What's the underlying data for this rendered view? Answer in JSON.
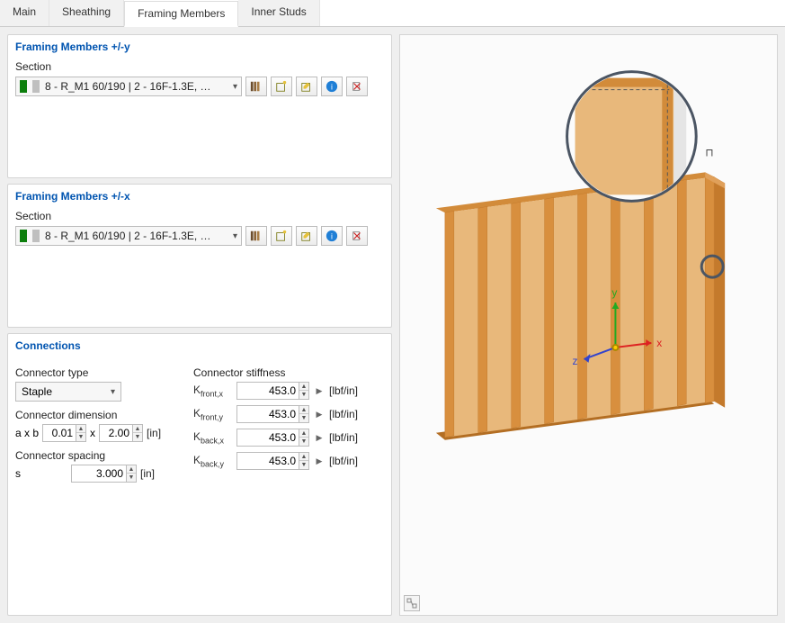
{
  "tabs": [
    "Main",
    "Sheathing",
    "Framing Members",
    "Inner Studs"
  ],
  "activeTab": 2,
  "panelY": {
    "title": "Framing Members +/-y",
    "sectionLabel": "Section",
    "combo": "8 - R_M1 60/190 | 2 - 16F-1.3E, Softwo..."
  },
  "panelX": {
    "title": "Framing Members +/-x",
    "sectionLabel": "Section",
    "combo": "8 - R_M1 60/190 | 2 - 16F-1.3E, Softwo..."
  },
  "connections": {
    "title": "Connections",
    "connectorTypeLabel": "Connector type",
    "connectorType": "Staple",
    "connectorDimensionLabel": "Connector dimension",
    "dim": {
      "label": "a x b",
      "a": "0.01",
      "b": "2.00",
      "unit": "[in]"
    },
    "connectorSpacingLabel": "Connector spacing",
    "spacing": {
      "label": "s",
      "value": "3.000",
      "unit": "[in]"
    },
    "stiffnessTitle": "Connector stiffness",
    "stiffness": [
      {
        "label": "Kfront,x",
        "value": "453.0",
        "unit": "[lbf/in]"
      },
      {
        "label": "Kfront,y",
        "value": "453.0",
        "unit": "[lbf/in]"
      },
      {
        "label": "Kback,x",
        "value": "453.0",
        "unit": "[lbf/in]"
      },
      {
        "label": "Kback,y",
        "value": "453.0",
        "unit": "[lbf/in]"
      }
    ]
  },
  "axes": {
    "x": "x",
    "y": "y",
    "z": "z"
  }
}
